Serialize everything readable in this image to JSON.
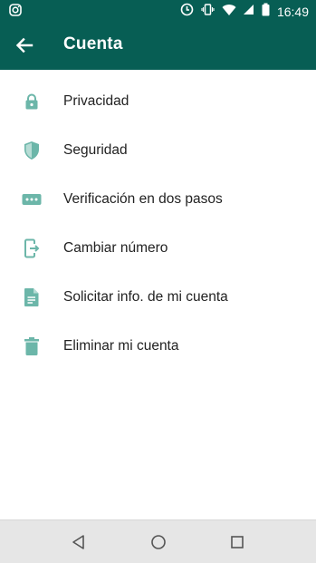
{
  "status": {
    "time": "16:49"
  },
  "header": {
    "title": "Cuenta"
  },
  "items": [
    {
      "label": "Privacidad",
      "icon": "lock-icon"
    },
    {
      "label": "Seguridad",
      "icon": "shield-icon"
    },
    {
      "label": "Verificación en dos pasos",
      "icon": "password-dots-icon"
    },
    {
      "label": "Cambiar número",
      "icon": "phone-transfer-icon"
    },
    {
      "label": "Solicitar info. de mi cuenta",
      "icon": "document-icon"
    },
    {
      "label": "Eliminar mi cuenta",
      "icon": "trash-icon"
    }
  ],
  "colors": {
    "primary": "#075e54",
    "icon": "#6cb6a9"
  }
}
